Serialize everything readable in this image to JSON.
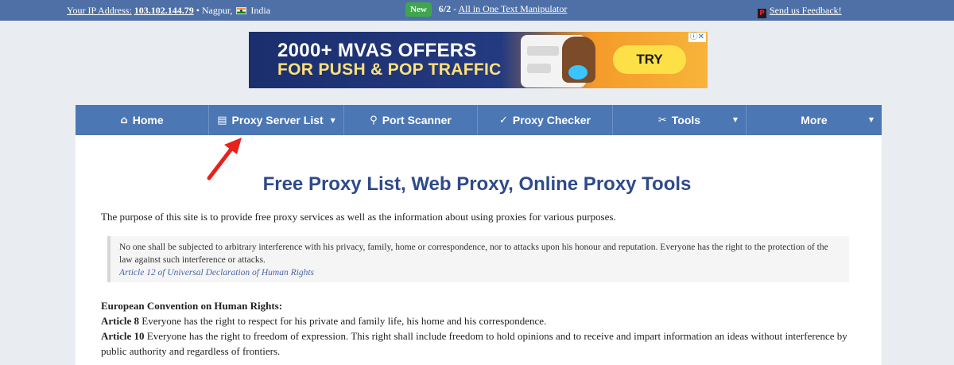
{
  "topbar": {
    "ip_label": "Your IP Address:",
    "ip_value": "103.102.144.79",
    "location_sep": "•",
    "city": "Nagpur,",
    "country": "India",
    "new_badge": "New",
    "news_date": "6/2",
    "news_sep": "-",
    "news_link": "All in One Text Manipulator",
    "feedback_icon_glyph": "P",
    "feedback_link": "Send us Feedback!"
  },
  "ad": {
    "line1": "2000+ MVAS OFFERS",
    "line2": "FOR PUSH & POP TRAFFIC",
    "cta": "TRY",
    "close_glyph": "ⓘ✕"
  },
  "nav": {
    "items": [
      {
        "label": "Home",
        "icon": "home-icon",
        "glyph": "⌂",
        "caret": ""
      },
      {
        "label": "Proxy Server List",
        "icon": "server-icon",
        "glyph": "▤",
        "caret": "▼"
      },
      {
        "label": "Port Scanner",
        "icon": "search-icon",
        "glyph": "⚲",
        "caret": ""
      },
      {
        "label": "Proxy Checker",
        "icon": "check-icon",
        "glyph": "✓",
        "caret": ""
      },
      {
        "label": "Tools",
        "icon": "tools-icon",
        "glyph": "✂",
        "caret": "▼"
      },
      {
        "label": "More",
        "icon": "",
        "glyph": "",
        "caret": "▼"
      }
    ]
  },
  "main": {
    "title": "Free Proxy List, Web Proxy, Online Proxy Tools",
    "intro": "The purpose of this site is to provide free proxy services as well as the information about using proxies for various purposes.",
    "quote_text": "No one shall be subjected to arbitrary interference with his privacy, family, home or correspondence, nor to attacks upon his honour and reputation. Everyone has the right to the protection of the law against such interference or attacks.",
    "quote_source": "Article 12 of Universal Declaration of Human Rights",
    "echr_heading": "European Convention on Human Rights:",
    "article8_label": "Article 8",
    "article8_text": " Everyone has the right to respect for his private and family life, his home and his correspondence.",
    "article10_label": "Article 10",
    "article10_text": " Everyone has the right to freedom of expression. This right shall include freedom to hold opinions and to receive and impart information an ideas without interference by public authority and regardless of frontiers."
  },
  "colors": {
    "topbar": "#4f70a6",
    "nav": "#4b77b4",
    "title": "#2e4a8a",
    "annotation_arrow": "#e8221b"
  }
}
